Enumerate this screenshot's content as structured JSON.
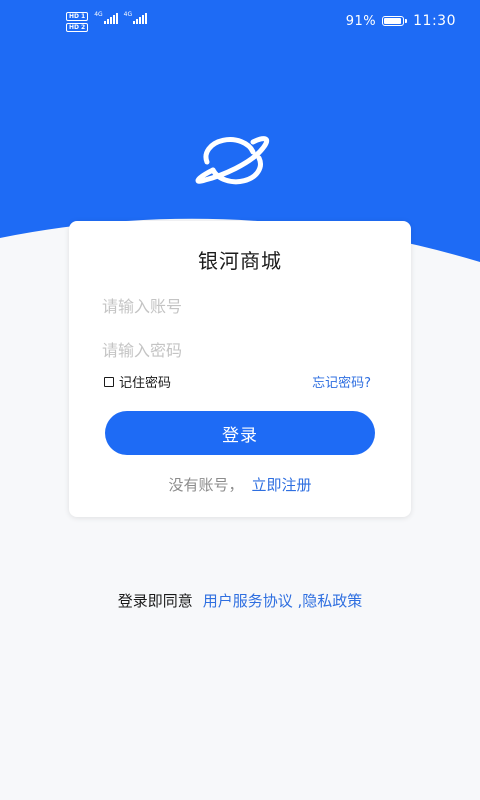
{
  "colors": {
    "header_blue": "#1e6bf5",
    "button_blue": "#1e6bf5",
    "link_blue": "#2f6fe0",
    "background": "#f7f8fa"
  },
  "status_bar": {
    "hd_label": "HD",
    "sim1": "1",
    "sim2": "2",
    "network1": "4G",
    "network2": "4G",
    "battery_level": 0.91,
    "battery_percent": "91%",
    "time": "11:30"
  },
  "logo_icon": "planet-icon",
  "login": {
    "title": "银河商城",
    "account_placeholder": "请输入账号",
    "password_placeholder": "请输入密码",
    "remember_label": "记住密码",
    "forgot_label": "忘记密码?",
    "submit_label": "登录",
    "no_account_text": "没有账号，",
    "register_label": "立即注册"
  },
  "agreement": {
    "prefix": "登录即同意",
    "terms_link": "用户服务协议",
    "separator": " ,",
    "privacy_link": "隐私政策"
  }
}
